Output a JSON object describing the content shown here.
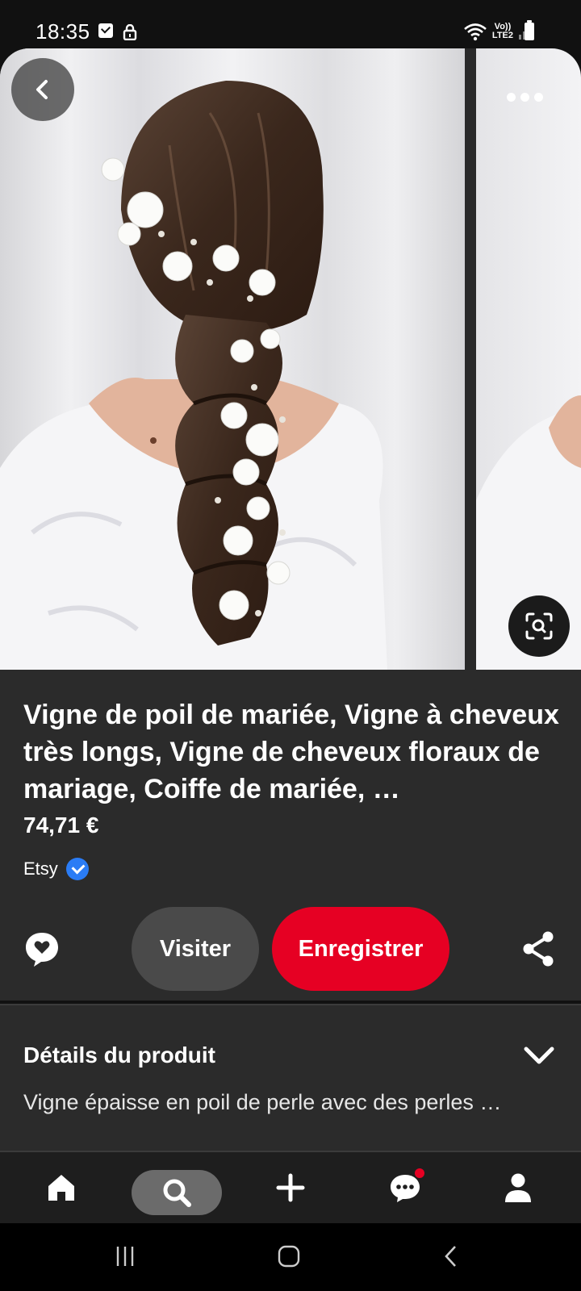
{
  "status_bar": {
    "time": "18:35",
    "network_top": "Vo))",
    "network_bottom": "LTE2"
  },
  "pin": {
    "title": "Vigne de poil de mariée, Vigne à cheveux très longs, Vigne de cheveux floraux de mariage, Coiffe de mariée, …",
    "price": "74,71 €",
    "merchant": "Etsy",
    "image_subject": "bridal-hair-vine-braid-photo"
  },
  "actions": {
    "visit_label": "Visiter",
    "save_label": "Enregistrer"
  },
  "details": {
    "heading": "Détails du produit",
    "description": "Vigne épaisse en poil de perle avec des perles …"
  },
  "bottom_nav": {
    "items": [
      "home-icon",
      "search-icon",
      "add-icon",
      "messages-icon",
      "profile-icon"
    ],
    "active": "search-icon"
  },
  "colors": {
    "save_button": "#e60023",
    "visit_button": "#4a4a4a",
    "panel_background": "#2b2b2b",
    "verified_badge": "#2a7cf5"
  }
}
